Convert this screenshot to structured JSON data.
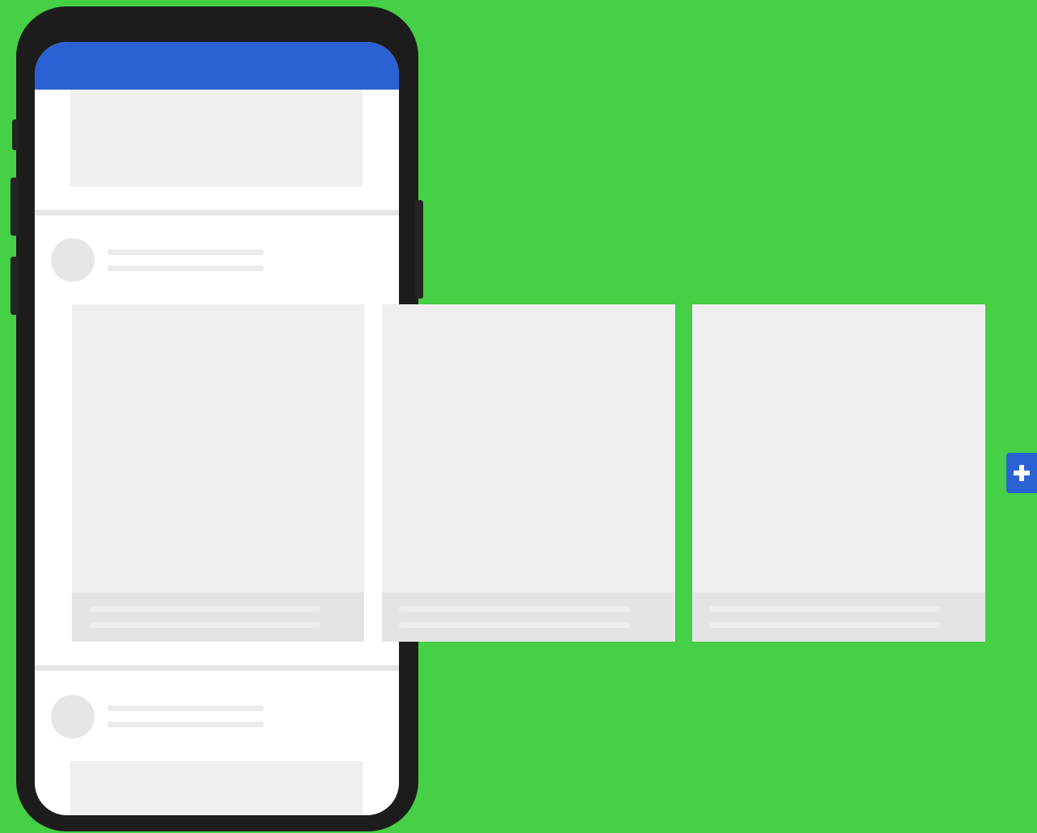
{
  "colors": {
    "background": "#45d045",
    "phone_frame": "#1c1c1c",
    "accent": "#2a62d4",
    "skeleton": "#efefef",
    "skeleton_footer": "#e4e4e4"
  },
  "phone": {
    "app_bar": {
      "color": "#2a62d4"
    },
    "feed": [
      {
        "type": "image-post"
      },
      {
        "type": "carousel-post",
        "cards": 3
      },
      {
        "type": "image-post"
      }
    ]
  },
  "carousel": {
    "cards": [
      {
        "index": 1
      },
      {
        "index": 2
      },
      {
        "index": 3
      }
    ],
    "add_button": {
      "icon": "plus-icon"
    }
  }
}
